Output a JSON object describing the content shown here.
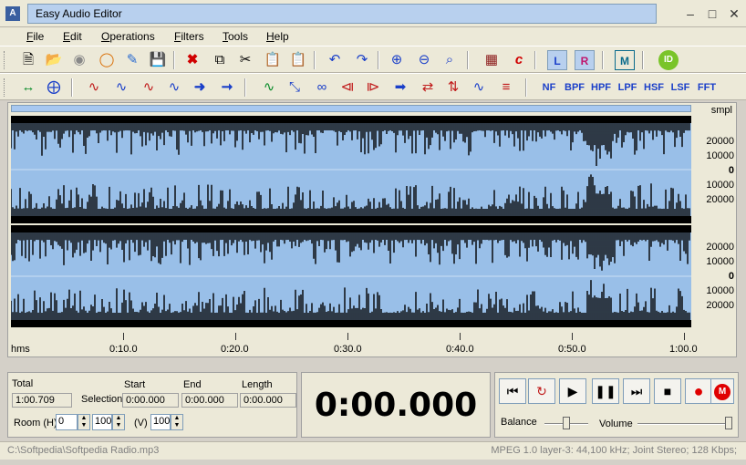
{
  "window": {
    "title": "Easy Audio Editor",
    "app_icon_glyph": "A"
  },
  "menu": [
    {
      "key": "F",
      "rest": "ile"
    },
    {
      "key": "E",
      "rest": "dit"
    },
    {
      "key": "O",
      "rest": "perations"
    },
    {
      "key": "F",
      "rest": "ilters"
    },
    {
      "key": "T",
      "rest": "ools"
    },
    {
      "key": "H",
      "rest": "elp"
    }
  ],
  "toolbar2_filters": [
    "NF",
    "BPF",
    "HPF",
    "LPF",
    "HSF",
    "LSF",
    "FFT"
  ],
  "channel_buttons": {
    "left": "L",
    "right": "R"
  },
  "waveform": {
    "scale_unit": "smpl",
    "channel1_scale": [
      "20000",
      "10000",
      "0",
      "10000",
      "20000"
    ],
    "channel2_scale": [
      "20000",
      "10000",
      "0",
      "10000",
      "20000"
    ],
    "timeline_unit": "hms",
    "timeline_ticks": [
      "0:10.0",
      "0:20.0",
      "0:30.0",
      "0:40.0",
      "0:50.0",
      "1:00.0"
    ],
    "colors": {
      "background": "#99bfe8",
      "peaks": "#000000"
    }
  },
  "info": {
    "total_label": "Total",
    "total_value": "1:00.709",
    "start_label": "Start",
    "end_label": "End",
    "length_label": "Length",
    "selection_label": "Selection",
    "start_value": "0:00.000",
    "end_value": "0:00.000",
    "length_value": "0:00.000",
    "room_h_label": "Room (H)",
    "room_h_value": "0",
    "room_h2_value": "100",
    "room_v_label": "(V)",
    "room_v_value": "100"
  },
  "current_time": "0:00.000",
  "transport": {
    "balance_label": "Balance",
    "volume_label": "Volume",
    "balance_level": 0.5,
    "volume_level": 1.0
  },
  "status": {
    "file_path": "C:\\Softpedia\\Softpedia Radio.mp3",
    "format": "MPEG 1.0 layer-3: 44,100 kHz; Joint Stereo; 128 Kbps;"
  }
}
